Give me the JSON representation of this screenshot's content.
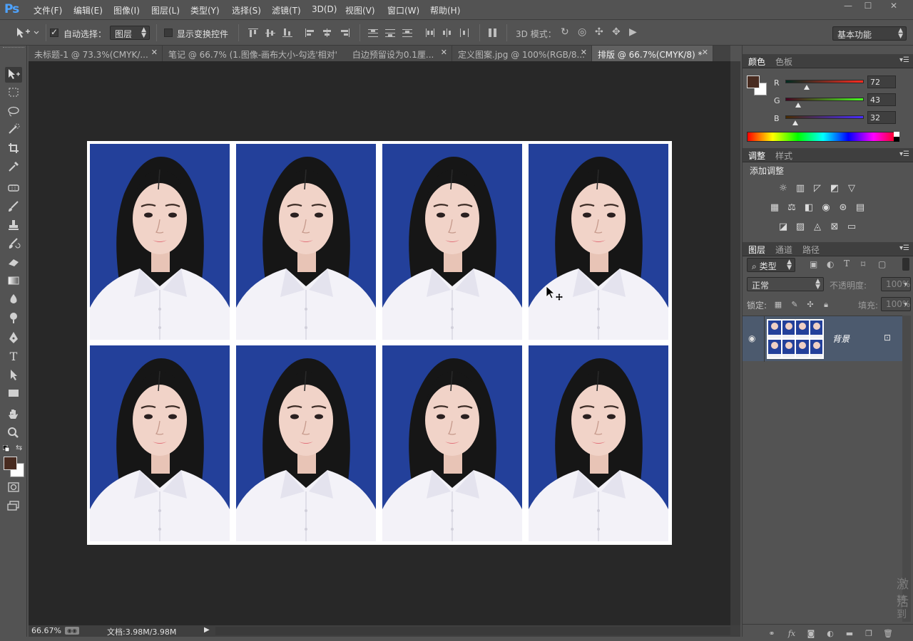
{
  "app": {
    "logo": "Ps"
  },
  "menu": [
    {
      "label": "文件(F)"
    },
    {
      "label": "编辑(E)"
    },
    {
      "label": "图像(I)"
    },
    {
      "label": "图层(L)"
    },
    {
      "label": "类型(Y)"
    },
    {
      "label": "选择(S)"
    },
    {
      "label": "滤镜(T)"
    },
    {
      "label": "3D(D)"
    },
    {
      "label": "视图(V)"
    },
    {
      "label": "窗口(W)"
    },
    {
      "label": "帮助(H)"
    }
  ],
  "window_controls": {
    "minimize": "—",
    "maximize": "☐",
    "close": "✕"
  },
  "options": {
    "auto_select_label": "自动选择：",
    "auto_select_target": "图层",
    "auto_select_checked": true,
    "show_transform_label": "显示变换控件",
    "show_transform_checked": false,
    "mode_3d_label": "3D 模式：",
    "workspace": "基本功能"
  },
  "tabs": [
    {
      "label": "未标题-1 @ 73.3%(CMYK/...",
      "active": false
    },
    {
      "label": "笔记 @ 66.7% (1.图像-画布大小-勾选'相对'",
      "active": false
    },
    {
      "label": "白边预留设为0.1厘...",
      "active": false
    },
    {
      "label": "定义图案.jpg @ 100%(RGB/8...",
      "active": false
    },
    {
      "label": "排版 @ 66.7%(CMYK/8) *",
      "active": true
    }
  ],
  "status": {
    "zoom": "66.67%",
    "doc": "文档:3.98M/3.98M"
  },
  "color_panel": {
    "tabs": [
      "颜色",
      "色板"
    ],
    "r_label": "R",
    "r": "72",
    "g_label": "G",
    "g": "43",
    "b_label": "B",
    "b": "32",
    "foreground": "#482b20",
    "background": "#ffffff"
  },
  "adjust_panel": {
    "tabs": [
      "调整",
      "样式"
    ],
    "title": "添加调整"
  },
  "layers_panel": {
    "tabs": [
      "图层",
      "通道",
      "路径"
    ],
    "filter_kind": "类型",
    "blend_mode": "正常",
    "opacity_label": "不透明度:",
    "opacity": "100%",
    "lock_label": "锁定:",
    "fill_label": "填充:",
    "fill": "100%",
    "layers": [
      {
        "name": "背景",
        "visible": true,
        "locked": true
      }
    ]
  },
  "watermark": {
    "line1": "激活",
    "line2": "转到"
  },
  "photos": {
    "count": 8,
    "background_color": "#23409a"
  }
}
